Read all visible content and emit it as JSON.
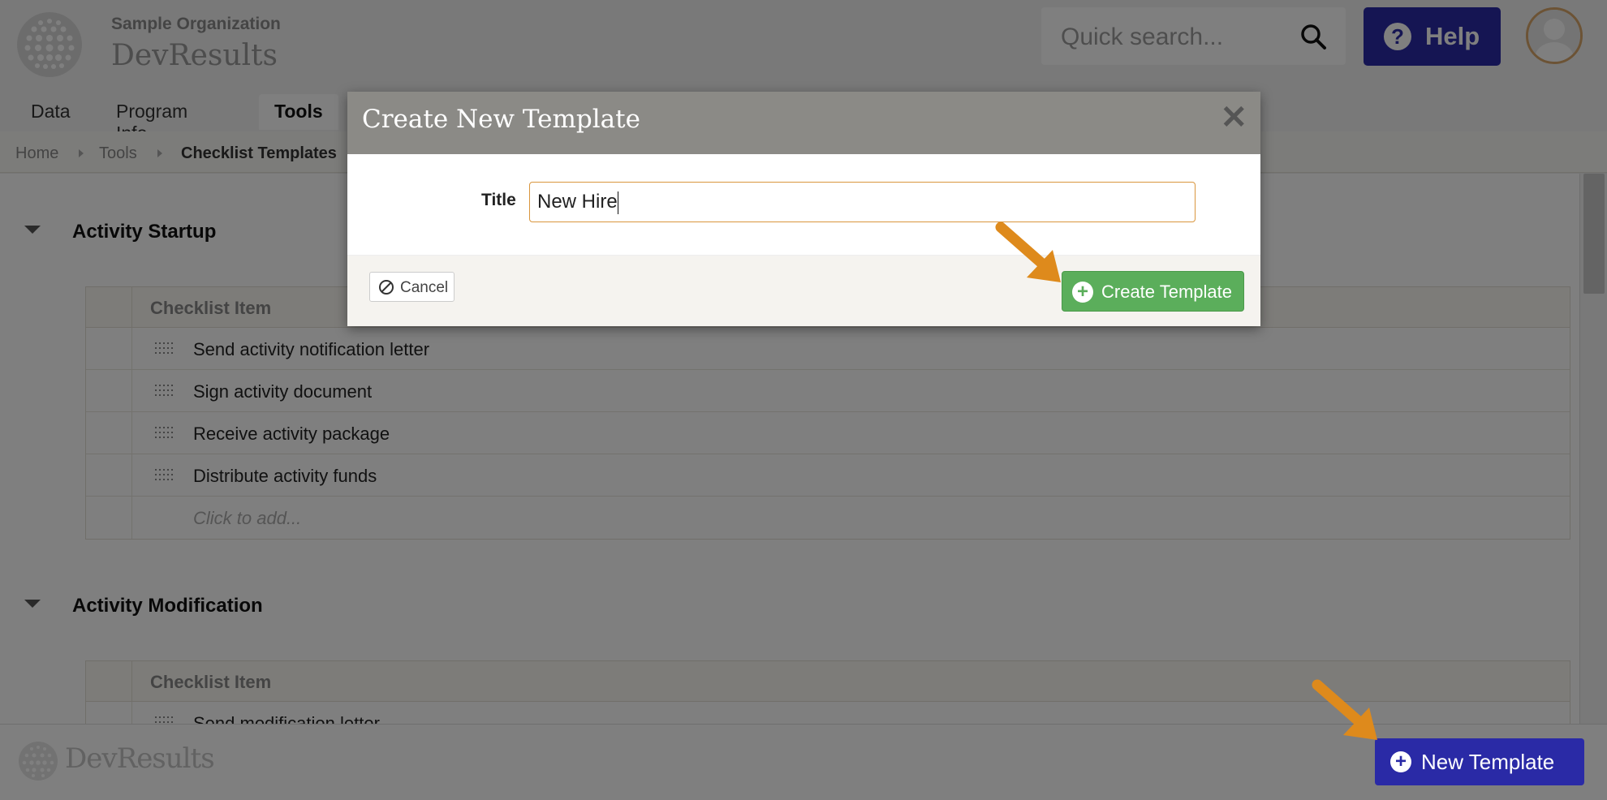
{
  "header": {
    "org_name": "Sample Organization",
    "app_name": "DevResults",
    "search_placeholder": "Quick search...",
    "help_label": "Help"
  },
  "nav": {
    "items": [
      {
        "label": "Data"
      },
      {
        "label": "Program Info"
      },
      {
        "label": "Tools",
        "active": true
      }
    ]
  },
  "breadcrumb": {
    "items": [
      "Home",
      "Tools",
      "Checklist Templates"
    ]
  },
  "sections": [
    {
      "title": "Activity Startup",
      "column_header": "Checklist Item",
      "items": [
        "Send activity notification letter",
        "Sign activity document",
        "Receive activity package",
        "Distribute activity funds"
      ],
      "add_placeholder": "Click to add..."
    },
    {
      "title": "Activity Modification",
      "column_header": "Checklist Item",
      "items": [
        "Send modification letter"
      ]
    }
  ],
  "footer": {
    "logo_text": "DevResults",
    "new_template_label": "New Template"
  },
  "modal": {
    "title": "Create New Template",
    "field_label": "Title",
    "title_value": "New Hire",
    "cancel_label": "Cancel",
    "create_label": "Create Template"
  },
  "colors": {
    "primary_blue": "#2a2aa6",
    "success_green": "#5bae5b",
    "annotation_orange": "#de8a1c",
    "modal_header": "#8b8a86"
  }
}
